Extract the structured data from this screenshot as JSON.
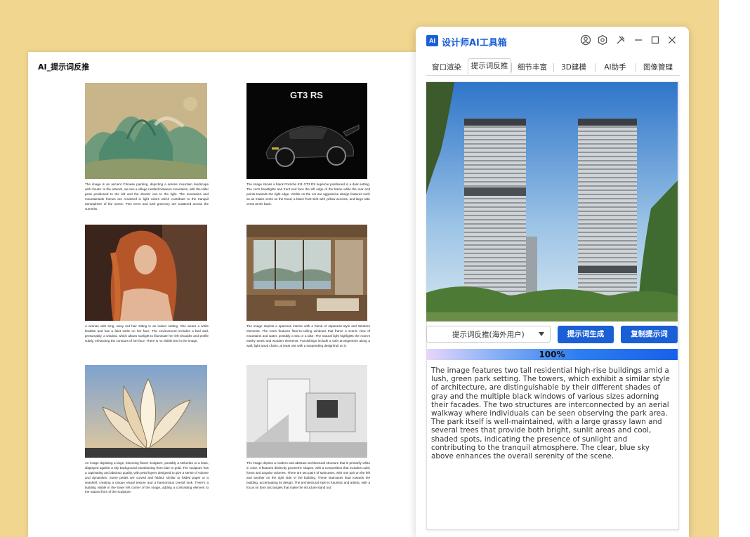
{
  "document": {
    "title": "AI_提示词反推",
    "cards": [
      {
        "thumb": "ancient-chinese-painting-thumbnail",
        "text": "The image is an ancient Chinese painting, depicting a serene mountain landscape with clouds. In the artwork, we see a village nestled between mountains, with the taller peak positioned to the left and the shorter one to the right. The mountains and mountainside homes are rendered in light colors which contribute to the tranquil atmosphere of the scene. Pine trees and lush greenery are scattered across the summits"
      },
      {
        "thumb": "porsche-gt3-rs-thumbnail",
        "badge": "GT3 RS",
        "text": "The image shows a black Porsche 911 GT3 RS supercar positioned in a dark setting. The car's headlights and front end face the left edge of the frame while the rear end points towards the right edge. Visible on the car are aggressive design features such as air intake vents on the hood, a black front skirt with yellow accents, and large side vents at the back."
      },
      {
        "thumb": "red-hair-woman-thumbnail",
        "text": "A woman with long, wavy red hair sitting in an indoor setting. She wears a white bralette and has a faint smile on her face. The environment includes a bed and, presumably, a window, which allows sunlight to illuminate her left shoulder and profile subtly, enhancing the contours of her face. There is no visible text in the image."
      },
      {
        "thumb": "japanese-interior-thumbnail",
        "text": "The image depicts a spacious interior with a blend of Japanese-style and Western elements. The room features floor-to-ceiling windows that frame a scenic view of mountains and water, possibly a sea or a lake. The natural light highlights the room's earthy tones and wooden elements. Furnishings include a sofa arrangement along a wall, light wood chairs, at least one with a suspending designfruit on it."
      },
      {
        "thumb": "flower-sculpture-thumbnail",
        "text": "An image depicting a large, blooming flower sculpture, possibly a Nelumbo or a lotus, displayed against a sky background transitioning from blue to gold. The sculpture has a captivating and abstract quality, with petal layers designed to give a sense of volume and dynamism. Some petals are curved and folded, similar to folded paper or a seashell, creating a unique visual texture and a harmonious overall look. There's a building visible in the lower left corner of the image, adding a contrasting element to the natural form of the sculpture."
      },
      {
        "thumb": "modern-architecture-thumbnail",
        "text": "The image depicts a modern and abstract architectural structure that is primarily white in color. It features distinctly geometric shapes, with a composition that includes cubic forms and angular volumes. There are two pairs of staircases, with one pair on the left and another on the right side of the building. These staircases lead towards the building, accentuating its design. The architectural style is futuristic and artistic, with a focus on form and angles that make the structure stand out."
      }
    ]
  },
  "app": {
    "logo": "AI",
    "title": "设计师AI工具箱",
    "window_icons": [
      "user-icon",
      "settings-icon",
      "pin-icon",
      "minimize-icon",
      "maximize-icon",
      "close-icon"
    ],
    "tabs": [
      {
        "label": "窗口渲染",
        "active": false
      },
      {
        "label": "提示词反推",
        "active": true
      },
      {
        "label": "细节丰富",
        "active": false
      },
      {
        "label": "3D建模",
        "active": false
      },
      {
        "label": "AI助手",
        "active": false
      },
      {
        "label": "图像管理",
        "active": false
      }
    ],
    "preview_image": "residential-towers-photo",
    "mode_select": {
      "value": "提示词反推(海外用户)"
    },
    "generate_button": "提示词生成",
    "copy_button": "复制提示词",
    "progress": {
      "label": "100%",
      "value": 1.0
    },
    "result_text": "The image features two tall residential high-rise buildings amid a lush, green park setting. The towers, which exhibit a similar style of architecture, are distinguishable by their different shades of gray and the multiple black windows of various sizes adorning their facades. The two structures are interconnected by an aerial walkway where individuals can be seen observing the park area. The park itself is well-maintained, with a large grassy lawn and several trees that provide both bright, sunlit areas and cool, shaded spots, indicating the presence of sunlight and contributing to the tranquil atmosphere. The clear, blue sky above enhances the overall serenity of the scene.",
    "colors": {
      "accent": "#1a5fd6",
      "background": "#f1d690"
    }
  }
}
